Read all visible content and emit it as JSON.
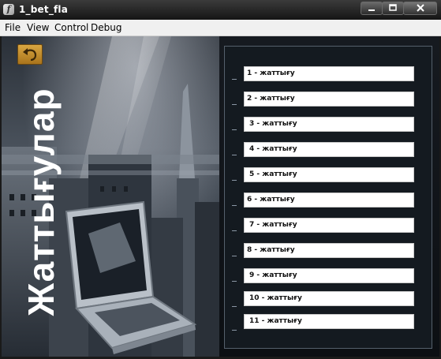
{
  "window": {
    "title": "1_bet_fla",
    "icon": "flash-player-icon",
    "controls": [
      "minimize",
      "maximize",
      "close"
    ]
  },
  "menu": {
    "items": [
      "File",
      "View",
      "Control",
      "Debug"
    ]
  },
  "content": {
    "vertical_title": "Жаттығулар",
    "back_button_icon": "undo-arrow-icon",
    "exercises": [
      "1 - жаттығу",
      "2 - жаттығу",
      "3 - жаттығу",
      "4 - жаттығу",
      "5 - жаттығу",
      "6 - жаттығу",
      "7 - жаттығу",
      "8 - жаттығу",
      "9 - жаттығу",
      "10 - жаттығу",
      "11 - жаттығу"
    ]
  },
  "colors": {
    "titlebar": "#1f1f1f",
    "panel_bg": "#141a20",
    "exercise_button_bg": "#ffffff",
    "back_button": "#c8912e"
  }
}
